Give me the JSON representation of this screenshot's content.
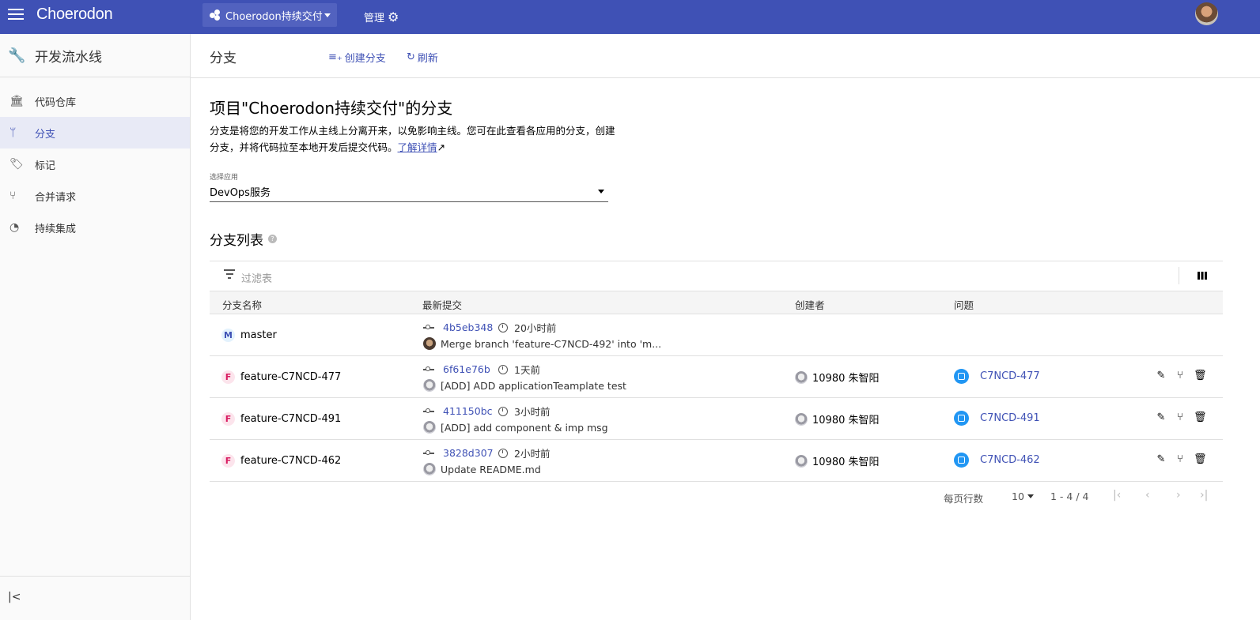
{
  "app": {
    "logo": "Choerodon"
  },
  "topbar": {
    "project": "Choerodon持续交付",
    "manage": "管理"
  },
  "sidebar": {
    "title": "开发流水线",
    "items": [
      {
        "label": "代码仓库",
        "icon": "bank-icon"
      },
      {
        "label": "分支",
        "icon": "branch-icon",
        "active": true
      },
      {
        "label": "标记",
        "icon": "tag-icon"
      },
      {
        "label": "合并请求",
        "icon": "merge-request-icon"
      },
      {
        "label": "持续集成",
        "icon": "ci-icon"
      }
    ],
    "collapse": "|<"
  },
  "header": {
    "title": "分支",
    "create_branch": "创建分支",
    "refresh": "刷新"
  },
  "main": {
    "heading": "项目\"Choerodon持续交付\"的分支",
    "description": "分支是将您的开发工作从主线上分离开来，以免影响主线。您可在此查看各应用的分支，创建分支，并将代码拉至本地开发后提交代码。",
    "learn_more": "了解详情",
    "select_label": "选择应用",
    "select_value": "DevOps服务",
    "list_title": "分支列表"
  },
  "table": {
    "filter_placeholder": "过滤表",
    "columns": [
      "分支名称",
      "最新提交",
      "创建者",
      "问题"
    ],
    "rows": [
      {
        "badge": "M",
        "name": "master",
        "sha": "4b5eb348",
        "time": "20小时前",
        "message": "Merge branch 'feature-C7NCD-492' into 'm...",
        "creator": "",
        "issue": ""
      },
      {
        "badge": "F",
        "name": "feature-C7NCD-477",
        "sha": "6f61e76b",
        "time": "1天前",
        "message": "[ADD] ADD applicationTeamplate test",
        "creator": "10980 朱智阳",
        "issue": "C7NCD-477"
      },
      {
        "badge": "F",
        "name": "feature-C7NCD-491",
        "sha": "411150bc",
        "time": "3小时前",
        "message": "[ADD] add component & imp msg",
        "creator": "10980 朱智阳",
        "issue": "C7NCD-491"
      },
      {
        "badge": "F",
        "name": "feature-C7NCD-462",
        "sha": "3828d307",
        "time": "2小时前",
        "message": "Update README.md",
        "creator": "10980 朱智阳",
        "issue": "C7NCD-462"
      }
    ]
  },
  "pagination": {
    "rows_per_page_label": "每页行数",
    "rows_per_page": "10",
    "range": "1 - 4 / 4"
  },
  "colors": {
    "primary": "#3f51b5",
    "issue": "#2196f3"
  }
}
